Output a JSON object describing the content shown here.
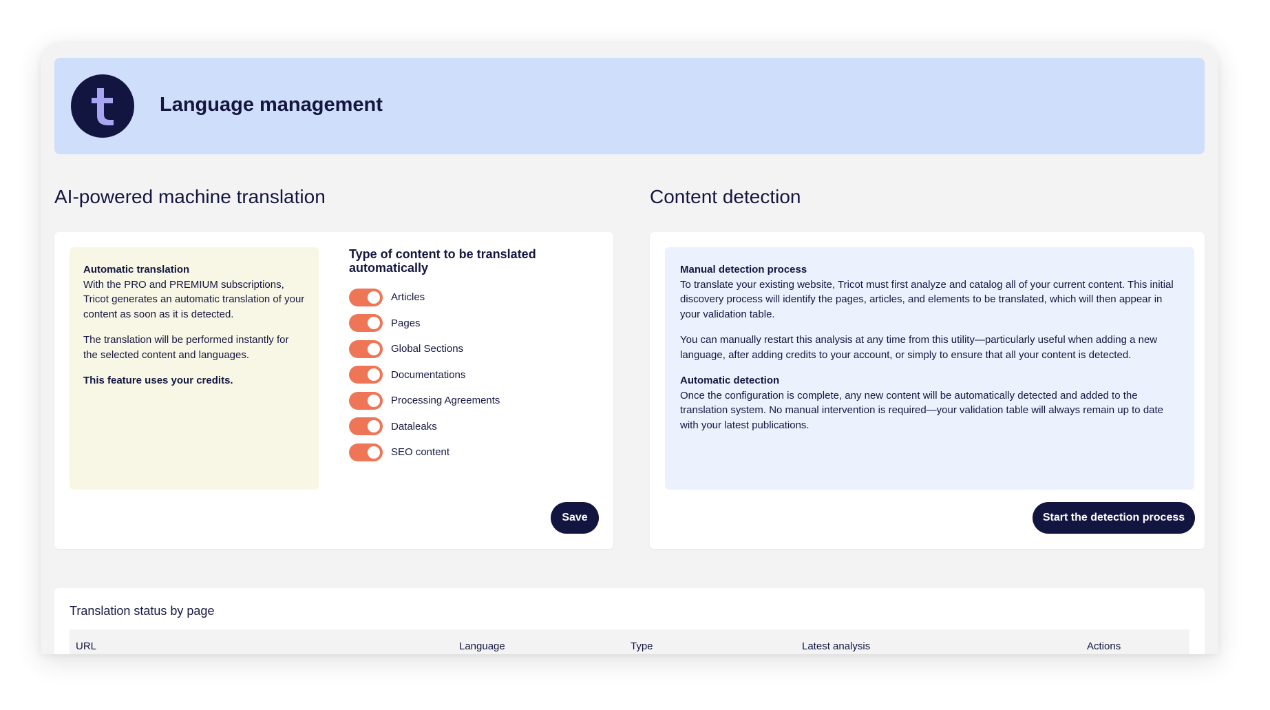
{
  "header": {
    "title": "Language management",
    "logo_icon": "tricot-logo-icon",
    "logo_color": "#131541",
    "logo_accent": "#a8a6f2"
  },
  "translation": {
    "heading": "AI-powered machine translation",
    "info": {
      "title": "Automatic translation",
      "p1": "With the PRO and PREMIUM subscriptions, Tricot generates an automatic translation of your content as soon as it is detected.",
      "p2": "The translation will be performed instantly for the selected content and languages.",
      "p3": "This feature uses your credits."
    },
    "content_types_title": "Type of content to be translated automatically",
    "toggles": [
      {
        "label": "Articles",
        "on": true
      },
      {
        "label": "Pages",
        "on": true
      },
      {
        "label": "Global Sections",
        "on": true
      },
      {
        "label": "Documentations",
        "on": true
      },
      {
        "label": "Processing Agreements",
        "on": true
      },
      {
        "label": "Dataleaks",
        "on": true
      },
      {
        "label": "SEO content",
        "on": true
      }
    ],
    "save_label": "Save",
    "toggle_color": "#ee7656"
  },
  "detection": {
    "heading": "Content detection",
    "manual_title": "Manual detection process",
    "manual_p1": "To translate your existing website, Tricot must first analyze and catalog all of your current content. This initial discovery process will identify the pages, articles, and elements to be translated, which will then appear in your validation table.",
    "manual_p2": "You can manually restart this analysis at any time from this utility—particularly useful when adding a new language, after adding credits to your account, or simply to ensure that all your content is detected.",
    "auto_title": "Automatic detection",
    "auto_p1": "Once the configuration is complete, any new content will be automatically detected and added to the translation system. No manual intervention is required—your validation table will always remain up to date with your latest publications.",
    "start_label": "Start the detection process"
  },
  "status_table": {
    "title": "Translation status by page",
    "columns": [
      "URL",
      "Language",
      "Type",
      "Latest analysis",
      "Actions"
    ]
  }
}
